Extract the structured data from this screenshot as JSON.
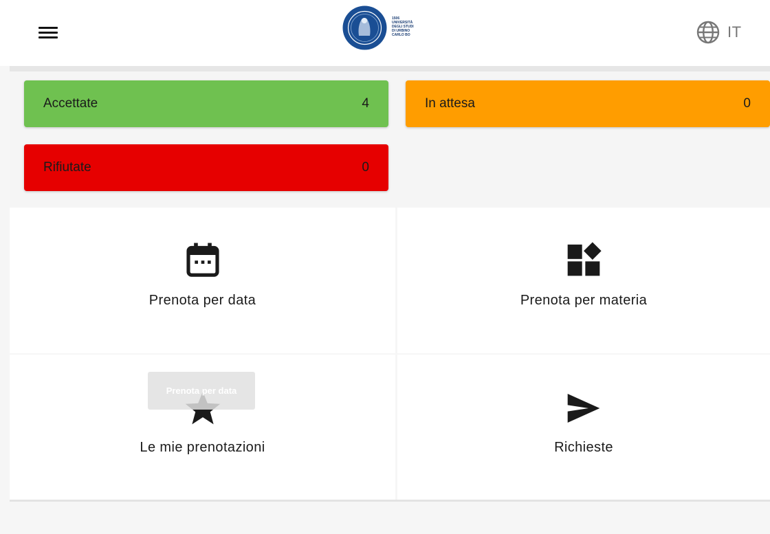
{
  "header": {
    "menu_icon": "hamburger-menu-icon",
    "logo": {
      "year": "1506",
      "lines": [
        "UNIVERSITÀ",
        "DEGLI STUDI",
        "DI URBINO",
        "CARLO BO"
      ],
      "color": "#1a4e94"
    },
    "language": {
      "icon": "globe-icon",
      "label": "IT"
    }
  },
  "status": [
    {
      "label": "Accettate",
      "count": "4",
      "color": "#6fc150"
    },
    {
      "label": "In attesa",
      "count": "0",
      "color": "#ff9d00"
    },
    {
      "label": "Rifiutate",
      "count": "0",
      "color": "#e60000"
    }
  ],
  "menu": [
    {
      "label": "Prenota per data",
      "icon": "calendar-icon"
    },
    {
      "label": "Prenota per materia",
      "icon": "category-icon"
    },
    {
      "label": "Le mie prenotazioni",
      "icon": "star-icon"
    },
    {
      "label": "Richieste",
      "icon": "send-icon"
    }
  ],
  "tooltip": {
    "text": "Prenota per data"
  }
}
